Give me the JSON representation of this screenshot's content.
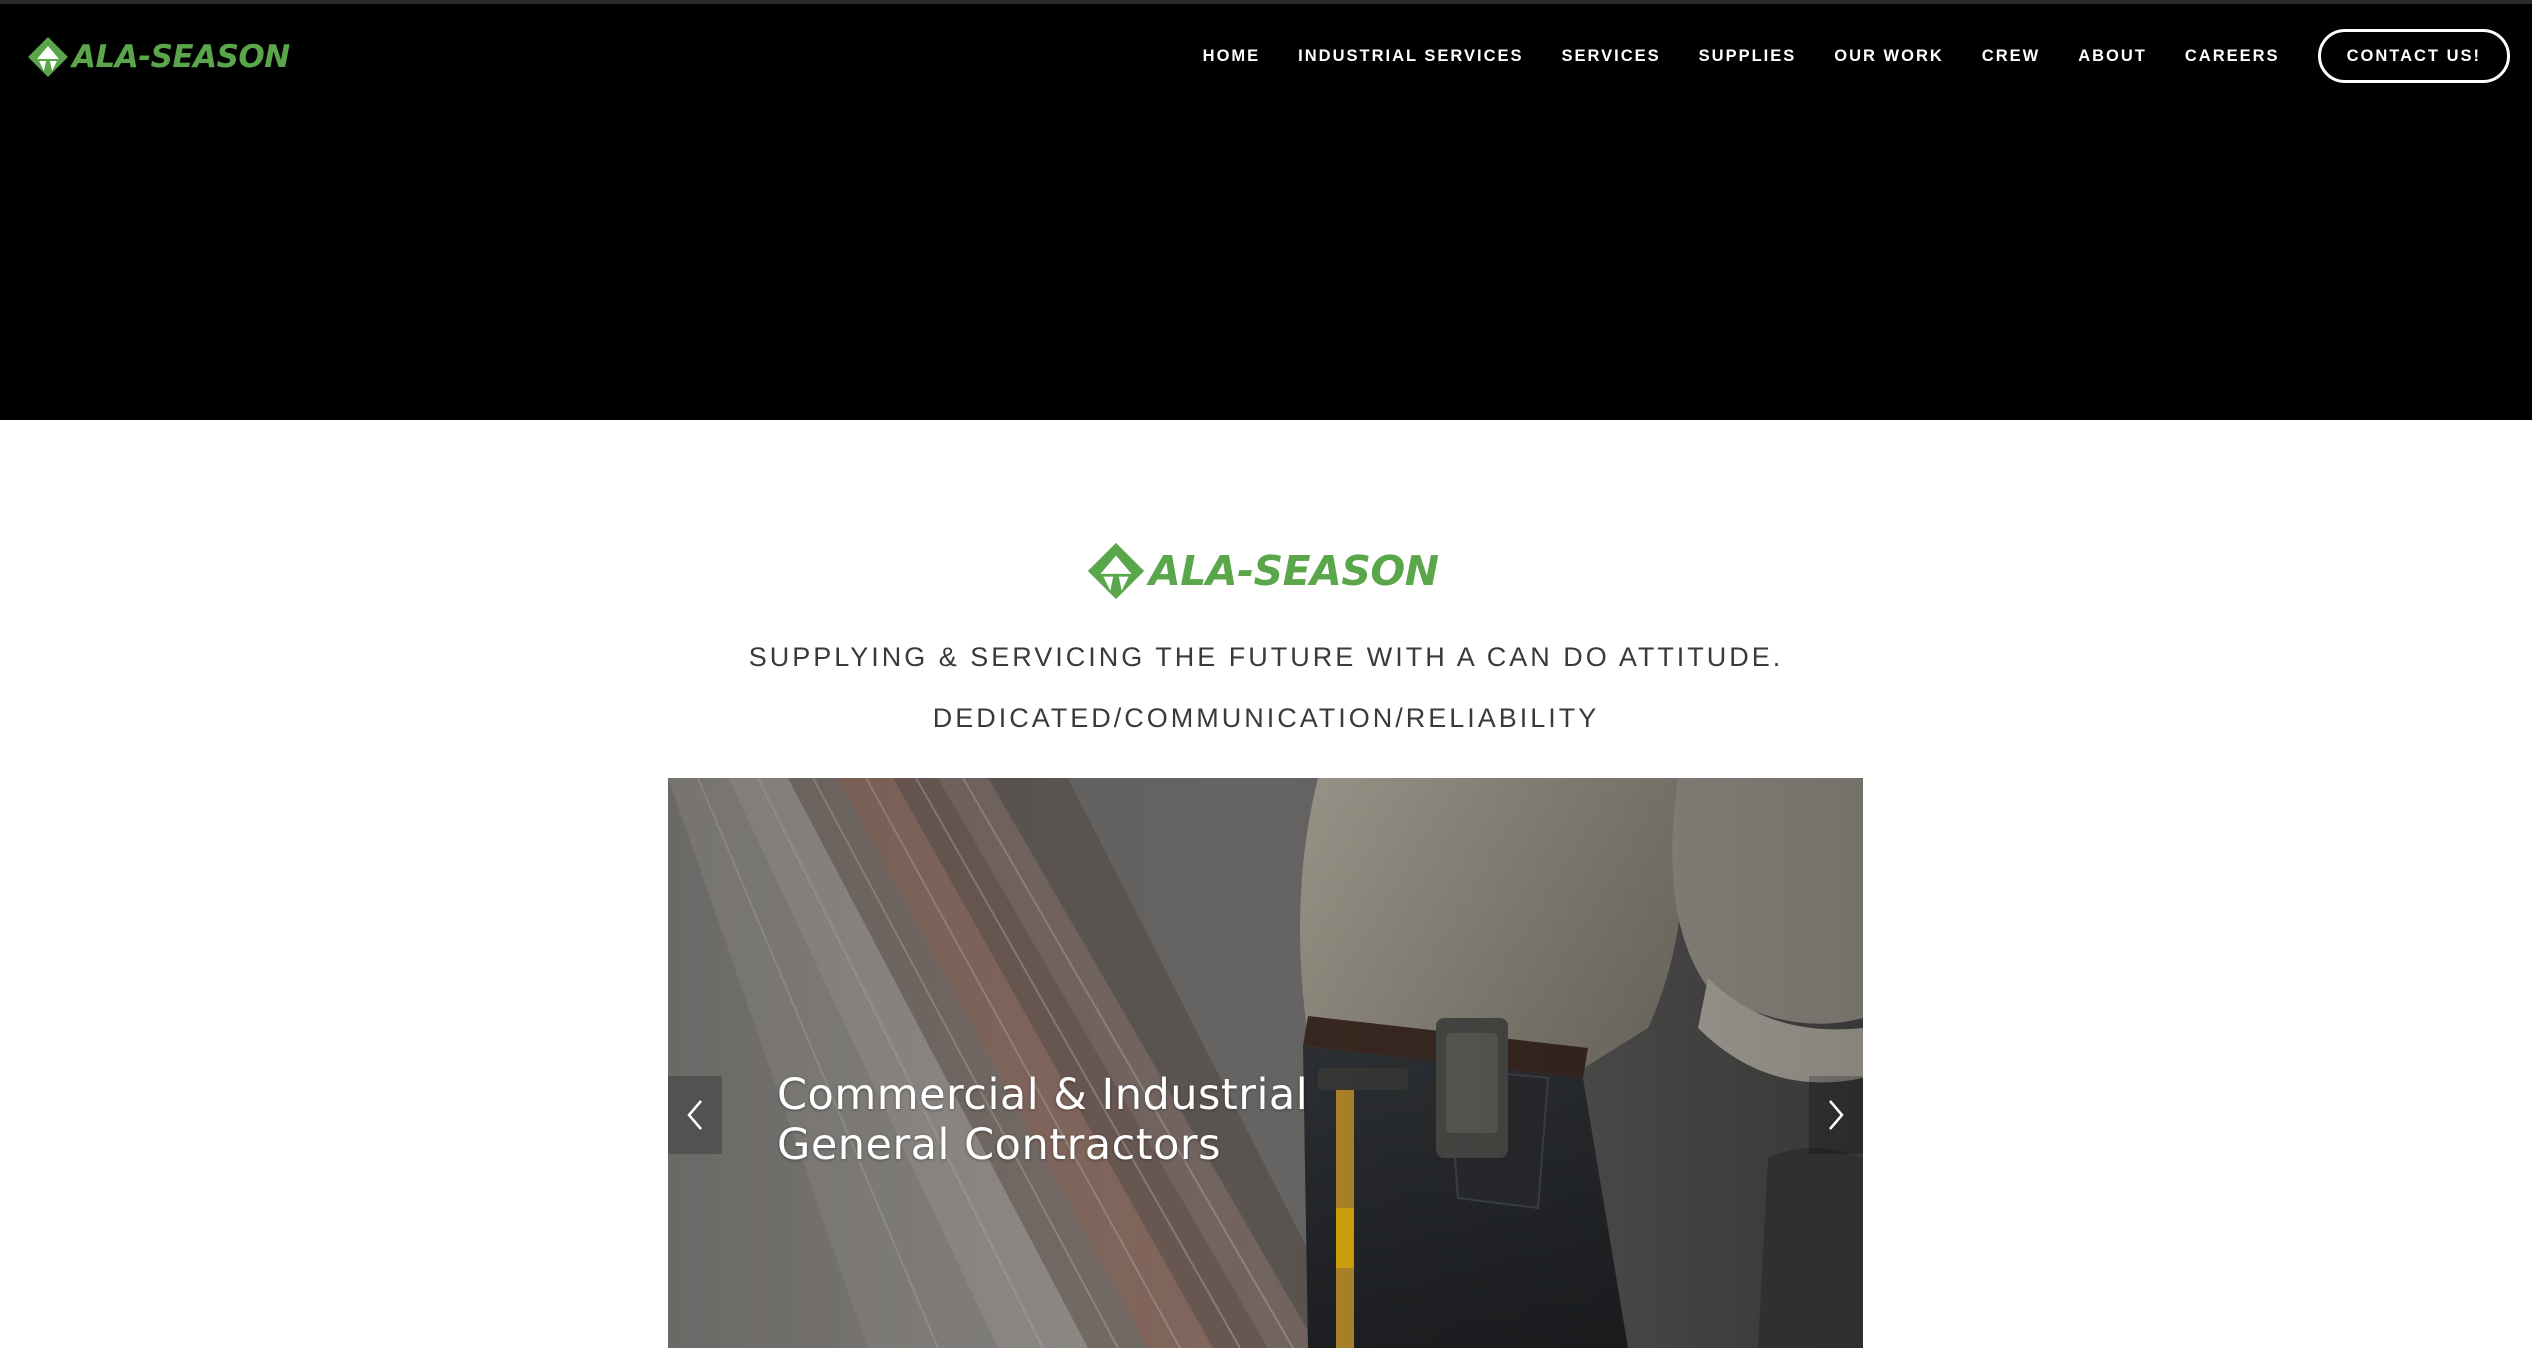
{
  "brand": {
    "name": "ALA-SEASON",
    "color": "#5aa64a",
    "icon": "ala-season-logo-icon"
  },
  "nav": {
    "items": [
      {
        "label": "HOME"
      },
      {
        "label": "INDUSTRIAL SERVICES"
      },
      {
        "label": "SERVICES"
      },
      {
        "label": "SUPPLIES"
      },
      {
        "label": "OUR WORK"
      },
      {
        "label": "CREW"
      },
      {
        "label": "ABOUT"
      },
      {
        "label": "CAREERS"
      }
    ],
    "contact_label": "CONTACT US!"
  },
  "content": {
    "logo_text": "ALA-SEASON",
    "tagline_1": "SUPPLYING & SERVICING THE FUTURE WITH A CAN DO ATTITUDE.",
    "tagline_2": "DEDICATED/COMMUNICATION/RELIABILITY"
  },
  "slider": {
    "caption_line_1": "Commercial & Industrial",
    "caption_line_2": "General Contractors",
    "prev_icon": "chevron-left-icon",
    "next_icon": "chevron-right-icon"
  },
  "colors": {
    "header_bg": "#000000",
    "page_bg": "#ffffff",
    "accent_green": "#5aa64a",
    "tagline_text": "#3a3a3a"
  }
}
